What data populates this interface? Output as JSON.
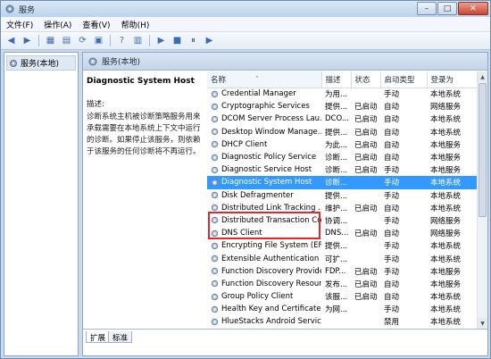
{
  "window": {
    "title": "服务",
    "min": "–",
    "max": "□",
    "close": "✕"
  },
  "menu": [
    "文件(F)",
    "操作(A)",
    "查看(V)",
    "帮助(H)"
  ],
  "toolbar": [
    "◀",
    "▶",
    "▦",
    "▤",
    "⟳",
    "▣",
    "?",
    "▥",
    "▶",
    "■",
    "⏸",
    "▶"
  ],
  "tree": {
    "root": "服务(本地)"
  },
  "main": {
    "header": "服务(本地)"
  },
  "description": {
    "title": "Diagnostic System Host",
    "label": "描述:",
    "text": "诊断系统主机被诊断策略服务用来承载需要在本地系统上下文中运行的诊断。如果停止该服务，则依赖于该服务的任何诊断将不再运行。"
  },
  "table": {
    "columns": [
      "名称",
      "描述",
      "状态",
      "启动类型",
      "登录为"
    ],
    "sort_arrow": "˄",
    "rows": [
      [
        "Credential Manager",
        "为用...",
        "",
        "手动",
        "本地系统"
      ],
      [
        "Cryptographic Services",
        "提供...",
        "已启动",
        "自动",
        "网络服务"
      ],
      [
        "DCOM Server Process Lau...",
        "DCO...",
        "已启动",
        "自动",
        "本地系统"
      ],
      [
        "Desktop Window Manage...",
        "提供...",
        "已启动",
        "自动",
        "本地系统"
      ],
      [
        "DHCP Client",
        "为此...",
        "已启动",
        "自动",
        "本地服务"
      ],
      [
        "Diagnostic Policy Service",
        "诊断...",
        "已启动",
        "自动",
        "本地服务"
      ],
      [
        "Diagnostic Service Host",
        "诊断...",
        "已启动",
        "手动",
        "本地服务"
      ],
      [
        "Diagnostic System Host",
        "诊断...",
        "",
        "手动",
        "本地系统"
      ],
      [
        "Disk Defragmenter",
        "提供...",
        "",
        "手动",
        "本地系统"
      ],
      [
        "Distributed Link Tracking ...",
        "维护...",
        "已启动",
        "自动",
        "本地系统"
      ],
      [
        "Distributed Transaction Co...",
        "协调...",
        "",
        "手动",
        "网络服务"
      ],
      [
        "DNS Client",
        "DNS...",
        "已启动",
        "自动",
        "网络服务"
      ],
      [
        "Encrypting File System (EFS)",
        "提供...",
        "",
        "手动",
        "本地系统"
      ],
      [
        "Extensible Authentication P...",
        "可扩...",
        "",
        "手动",
        "本地系统"
      ],
      [
        "Function Discovery Provide...",
        "FDP...",
        "已启动",
        "手动",
        "本地服务"
      ],
      [
        "Function Discovery Resour...",
        "发布...",
        "已启动",
        "自动",
        "本地服务"
      ],
      [
        "Group Policy Client",
        "该服...",
        "已启动",
        "自动",
        "本地系统"
      ],
      [
        "Health Key and Certificate ...",
        "为网...",
        "",
        "手动",
        "本地系统"
      ],
      [
        "HlueStacks Android Service",
        "",
        "",
        "禁用",
        "本地系统"
      ]
    ],
    "selected_row": 7
  },
  "scrollbar": {
    "up": "▲",
    "down": "▼"
  },
  "tabs": [
    "扩展",
    "标准"
  ],
  "colors": {
    "selection": "#3399ff",
    "highlight_box": "#e0282d"
  }
}
